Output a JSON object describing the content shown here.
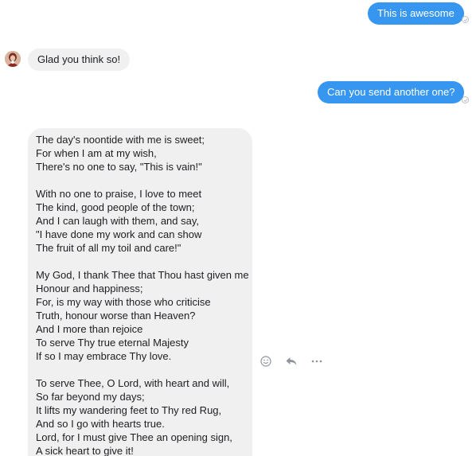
{
  "messages": {
    "out1": "This is awesome",
    "in1": "Glad you think so!",
    "out2": "Can you send another one?"
  },
  "poem": {
    "stanzas": [
      [
        "The day's noontide with me is sweet;",
        "For when I am at my wish,",
        "There's no one to say, \"This is vain!\""
      ],
      [
        "With no one to praise, I love to meet",
        "The kind, good people of the town;",
        "And I can laugh with them, and say,",
        "\"I have done my work and can show",
        "The fruit of all my toil and care!\""
      ],
      [
        "My God, I thank Thee that Thou hast given me",
        "Honour and happiness;",
        "For, is my way with those who criticise",
        "Truth, honour worse than Heaven?",
        "And I more than rejoice",
        "To serve Thy true eternal Majesty",
        "If so I may embrace Thy love."
      ],
      [
        "To serve Thee, O Lord, with heart and will,",
        "So far beyond my days;",
        "It lifts my wandering feet to Thy red Rug,",
        "And so I go with hearts true.",
        "Lord, for I must give Thee an opening sign,",
        "A sick heart to give it!"
      ]
    ]
  },
  "icons": {
    "sent": "check-circle-icon",
    "react": "smiley-icon",
    "reply": "reply-icon",
    "more": "more-icon"
  },
  "colors": {
    "outgoing_bubble": "#3797f0",
    "incoming_bubble": "#f1f0f0",
    "icon_gray": "#8d949e"
  }
}
